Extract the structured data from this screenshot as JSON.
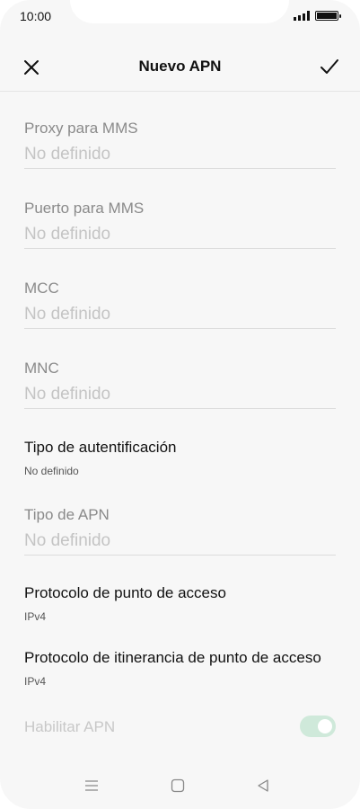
{
  "status_bar": {
    "time": "10:00",
    "icons": [
      "signal-icon",
      "battery-icon"
    ]
  },
  "header": {
    "title": "Nuevo APN",
    "close_icon": "close-icon",
    "confirm_icon": "checkmark-icon"
  },
  "fields": [
    {
      "label": "Proxy para MMS",
      "value": "No definido"
    },
    {
      "label": "Puerto para MMS",
      "value": "No definido"
    },
    {
      "label": "MCC",
      "value": "No definido"
    },
    {
      "label": "MNC",
      "value": "No definido"
    },
    {
      "label": "Tipo de APN",
      "value": "No definido"
    }
  ],
  "items": [
    {
      "title": "Tipo de autentificación",
      "value": "No definido"
    },
    {
      "title": "Protocolo de punto de acceso",
      "value": "IPv4"
    },
    {
      "title": "Protocolo de itinerancia de punto de acceso",
      "value": "IPv4"
    }
  ],
  "toggle": {
    "label": "Habilitar APN",
    "state": "on",
    "enabled": false,
    "accent_color": "#cfe9da"
  },
  "nav_bar": {
    "icons": [
      "menu-icon",
      "home-icon",
      "back-icon"
    ]
  }
}
